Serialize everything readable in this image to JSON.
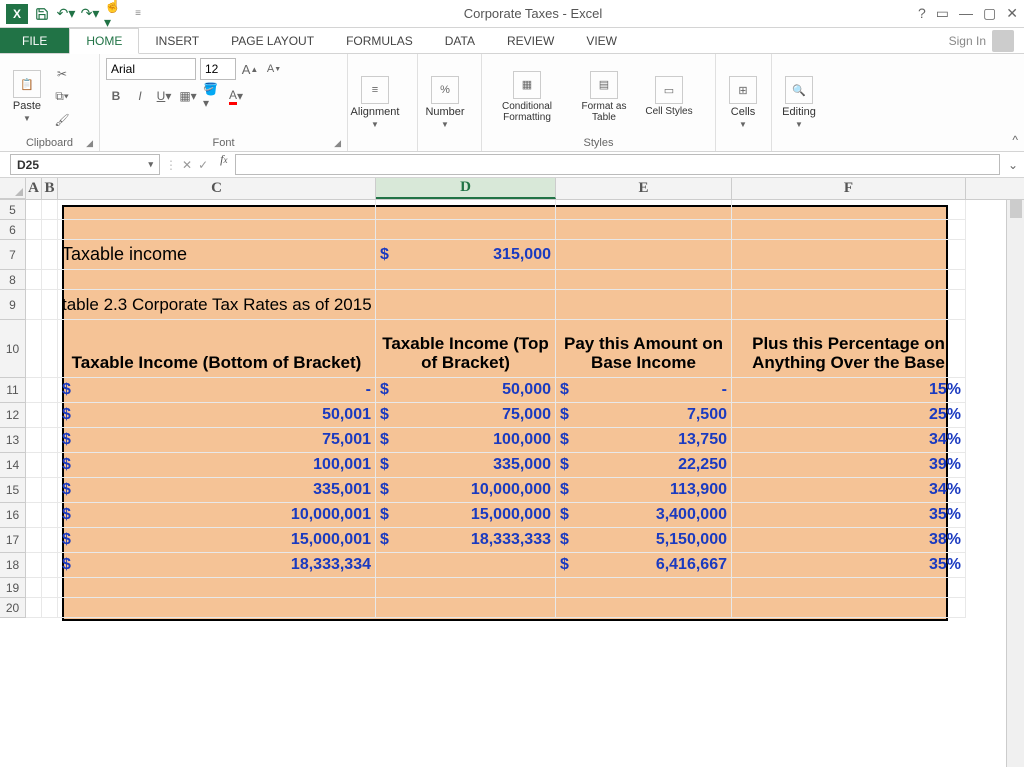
{
  "titlebar": {
    "title": "Corporate Taxes - Excel"
  },
  "tabs": {
    "file": "FILE",
    "home": "HOME",
    "insert": "INSERT",
    "page_layout": "PAGE LAYOUT",
    "formulas": "FORMULAS",
    "data": "DATA",
    "review": "REVIEW",
    "view": "VIEW",
    "signin": "Sign In"
  },
  "ribbon": {
    "paste": "Paste",
    "clipboard_label": "Clipboard",
    "font_name": "Arial",
    "font_size": "12",
    "font_label": "Font",
    "alignment": "Alignment",
    "number": "Number",
    "cond_fmt": "Conditional Formatting",
    "fmt_table": "Format as Table",
    "cell_styles": "Cell Styles",
    "styles_label": "Styles",
    "cells": "Cells",
    "editing": "Editing"
  },
  "fx": {
    "name_box": "D25",
    "value": ""
  },
  "columns": [
    "A",
    "B",
    "C",
    "D",
    "E",
    "F"
  ],
  "rows_visible": [
    "5",
    "6",
    "7",
    "8",
    "9",
    "10",
    "11",
    "12",
    "13",
    "14",
    "15",
    "16",
    "17",
    "18",
    "19",
    "20"
  ],
  "sheet": {
    "taxable_income_label": "Taxable income",
    "taxable_income_value": "315,000",
    "table_caption": "table 2.3    Corporate Tax Rates as of 2015",
    "headers": {
      "c": "Taxable Income (Bottom of Bracket)",
      "d": "Taxable Income (Top of Bracket)",
      "e": "Pay this Amount on Base Income",
      "f": "Plus this Percentage on Anything Over the Base"
    },
    "rows": [
      {
        "c": "-",
        "d": "50,000",
        "e": "-",
        "f": "15%"
      },
      {
        "c": "50,001",
        "d": "75,000",
        "e": "7,500",
        "f": "25%"
      },
      {
        "c": "75,001",
        "d": "100,000",
        "e": "13,750",
        "f": "34%"
      },
      {
        "c": "100,001",
        "d": "335,000",
        "e": "22,250",
        "f": "39%"
      },
      {
        "c": "335,001",
        "d": "10,000,000",
        "e": "113,900",
        "f": "34%"
      },
      {
        "c": "10,000,001",
        "d": "15,000,000",
        "e": "3,400,000",
        "f": "35%"
      },
      {
        "c": "15,000,001",
        "d": "18,333,333",
        "e": "5,150,000",
        "f": "38%"
      },
      {
        "c": "18,333,334",
        "d": "",
        "e": "6,416,667",
        "f": "35%"
      }
    ]
  },
  "chart_data": {
    "type": "table",
    "title": "table 2.3 Corporate Tax Rates as of 2015",
    "input": {
      "taxable_income": 315000
    },
    "columns": [
      "Taxable Income (Bottom of Bracket)",
      "Taxable Income (Top of Bracket)",
      "Pay this Amount on Base Income",
      "Plus this Percentage on Anything Over the Base"
    ],
    "rows": [
      [
        0,
        50000,
        0,
        0.15
      ],
      [
        50001,
        75000,
        7500,
        0.25
      ],
      [
        75001,
        100000,
        13750,
        0.34
      ],
      [
        100001,
        335000,
        22250,
        0.39
      ],
      [
        335001,
        10000000,
        113900,
        0.34
      ],
      [
        10000001,
        15000000,
        3400000,
        0.35
      ],
      [
        15000001,
        18333333,
        5150000,
        0.38
      ],
      [
        18333334,
        null,
        6416667,
        0.35
      ]
    ]
  }
}
